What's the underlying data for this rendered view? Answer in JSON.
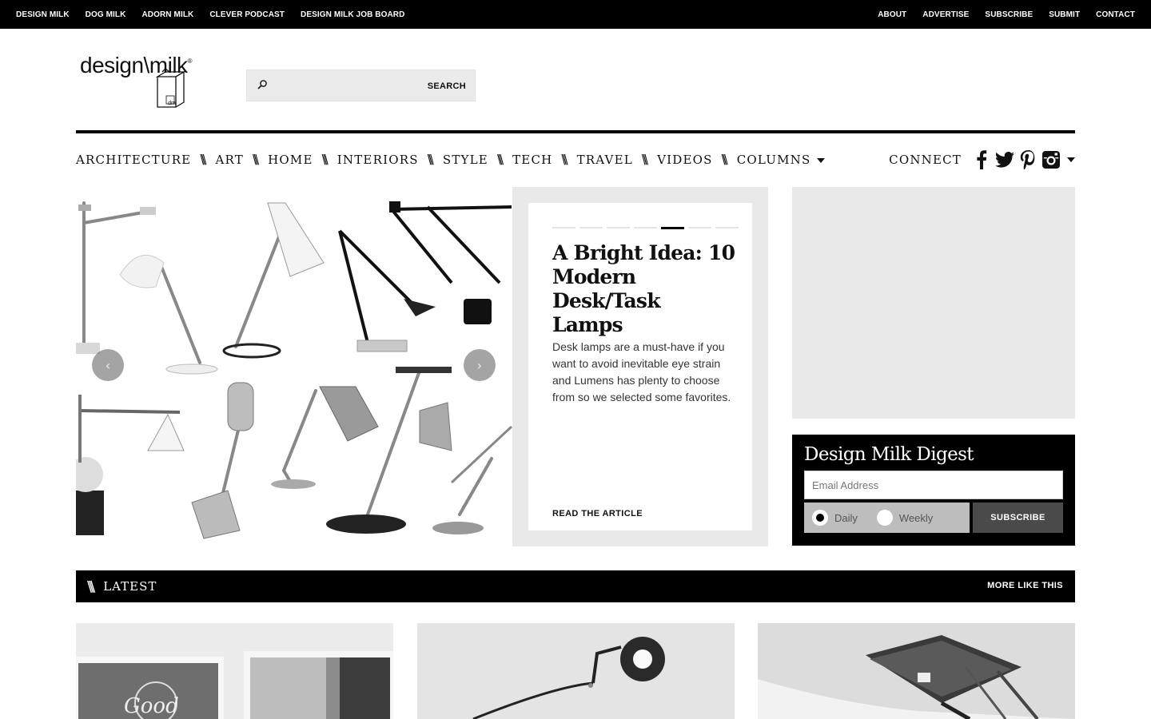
{
  "topnav": {
    "left": [
      "DESIGN MILK",
      "DOG MILK",
      "ADORN MILK",
      "CLEVER PODCAST",
      "DESIGN MILK JOB BOARD"
    ],
    "right": [
      "ABOUT",
      "ADVERTISE",
      "SUBSCRIBE",
      "SUBMIT",
      "CONTACT"
    ]
  },
  "logo": {
    "text": "design\\milk",
    "mark": "®",
    "carton": "dm"
  },
  "search": {
    "placeholder": "",
    "button": "SEARCH"
  },
  "categories": [
    "ARCHITECTURE",
    "ART",
    "HOME",
    "INTERIORS",
    "STYLE",
    "TECH",
    "TRAVEL",
    "VIDEOS",
    "COLUMNS"
  ],
  "category_separator": "\\\\\\",
  "connect": {
    "label": "CONNECT",
    "icons": [
      "facebook-icon",
      "twitter-icon",
      "pinterest-icon",
      "instagram-icon"
    ]
  },
  "hero": {
    "slide_count": 7,
    "active_slide": 5,
    "title": "A Bright Idea: 10 Modern Desk/Task Lamps",
    "description": "Desk lamps are a must-have if you want to avoid inevitable eye strain and Lumens has plenty to choose from so we selected some favorites.",
    "link": "READ THE ARTICLE",
    "prev_glyph": "‹",
    "next_glyph": "›"
  },
  "digest": {
    "title": "Design Milk Digest",
    "email_placeholder": "Email Address",
    "options": [
      "Daily",
      "Weekly"
    ],
    "selected": "Daily",
    "button": "SUBSCRIBE"
  },
  "latest": {
    "title": "LATEST",
    "glyph": "\\\\\\",
    "more": "MORE LIKE THIS",
    "thumb_text": "Good"
  },
  "colors": {
    "black": "#000000",
    "panel_gray": "#e9e9e9",
    "radio_gray": "#bdbdbd",
    "button_gray": "#4a4a4a"
  }
}
